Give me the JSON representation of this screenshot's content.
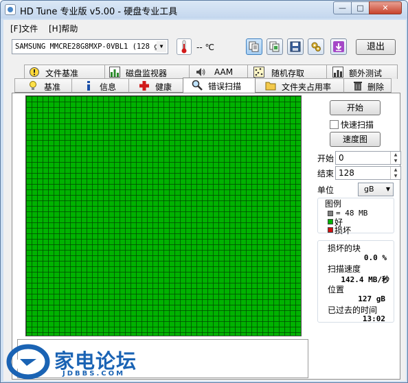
{
  "window": {
    "title": "HD Tune 专业版 v5.00 - 硬盘专业工具",
    "minimize": "—",
    "maximize": "□",
    "close": "✕"
  },
  "menu": {
    "file": "[F]文件",
    "help": "[H]帮助"
  },
  "toolbar": {
    "drive": "SAMSUNG MMCRE28G8MXP-0VBL1 (128 gB)",
    "temperature": "-- ℃",
    "exit_label": "退出",
    "icons": [
      "copy-text-icon",
      "copy-screen-icon",
      "save-icon",
      "options-icon",
      "download-icon"
    ]
  },
  "tabs_top": [
    {
      "label": "文件基准",
      "icon": "info-marker-icon"
    },
    {
      "label": "磁盘监视器",
      "icon": "bar-chart-icon"
    },
    {
      "label": "AAM",
      "icon": "speaker-icon"
    },
    {
      "label": "随机存取",
      "icon": "random-dots-icon"
    },
    {
      "label": "额外测试",
      "icon": "extra-test-icon"
    }
  ],
  "tabs_bottom": [
    {
      "label": "基准",
      "icon": "lightbulb-icon"
    },
    {
      "label": "信息",
      "icon": "info-icon"
    },
    {
      "label": "健康",
      "icon": "health-cross-icon"
    },
    {
      "label": "错误扫描",
      "icon": "magnifier-icon",
      "active": true
    },
    {
      "label": "文件夹占用率",
      "icon": "folder-icon"
    },
    {
      "label": "删除",
      "icon": "trash-icon"
    }
  ],
  "error_scan": {
    "start_button": "开始",
    "quick_scan_label": "快速扫描",
    "quick_scan_checked": false,
    "speed_map_button": "速度图",
    "start_label": "开始",
    "start_value": "0",
    "end_label": "结束",
    "end_value": "128",
    "unit_label": "单位",
    "unit_value": "gB",
    "legend": {
      "title": "图例",
      "block_size": "= 48 MB",
      "good": "好",
      "damaged": "损坏"
    },
    "stats": {
      "damaged_blocks_label": "损坏的块",
      "damaged_blocks_value": "0.0 %",
      "scan_speed_label": "扫描速度",
      "scan_speed_value": "142.4 MB/秒",
      "position_label": "位置",
      "position_value": "127 gB",
      "elapsed_label": "已过去的时间",
      "elapsed_value": "13:02"
    },
    "colors": {
      "good": "#00b200",
      "damaged": "#d01010",
      "block": "#808080"
    }
  },
  "watermark": {
    "text": "家电论坛",
    "sub": "JDBBS.COM"
  }
}
